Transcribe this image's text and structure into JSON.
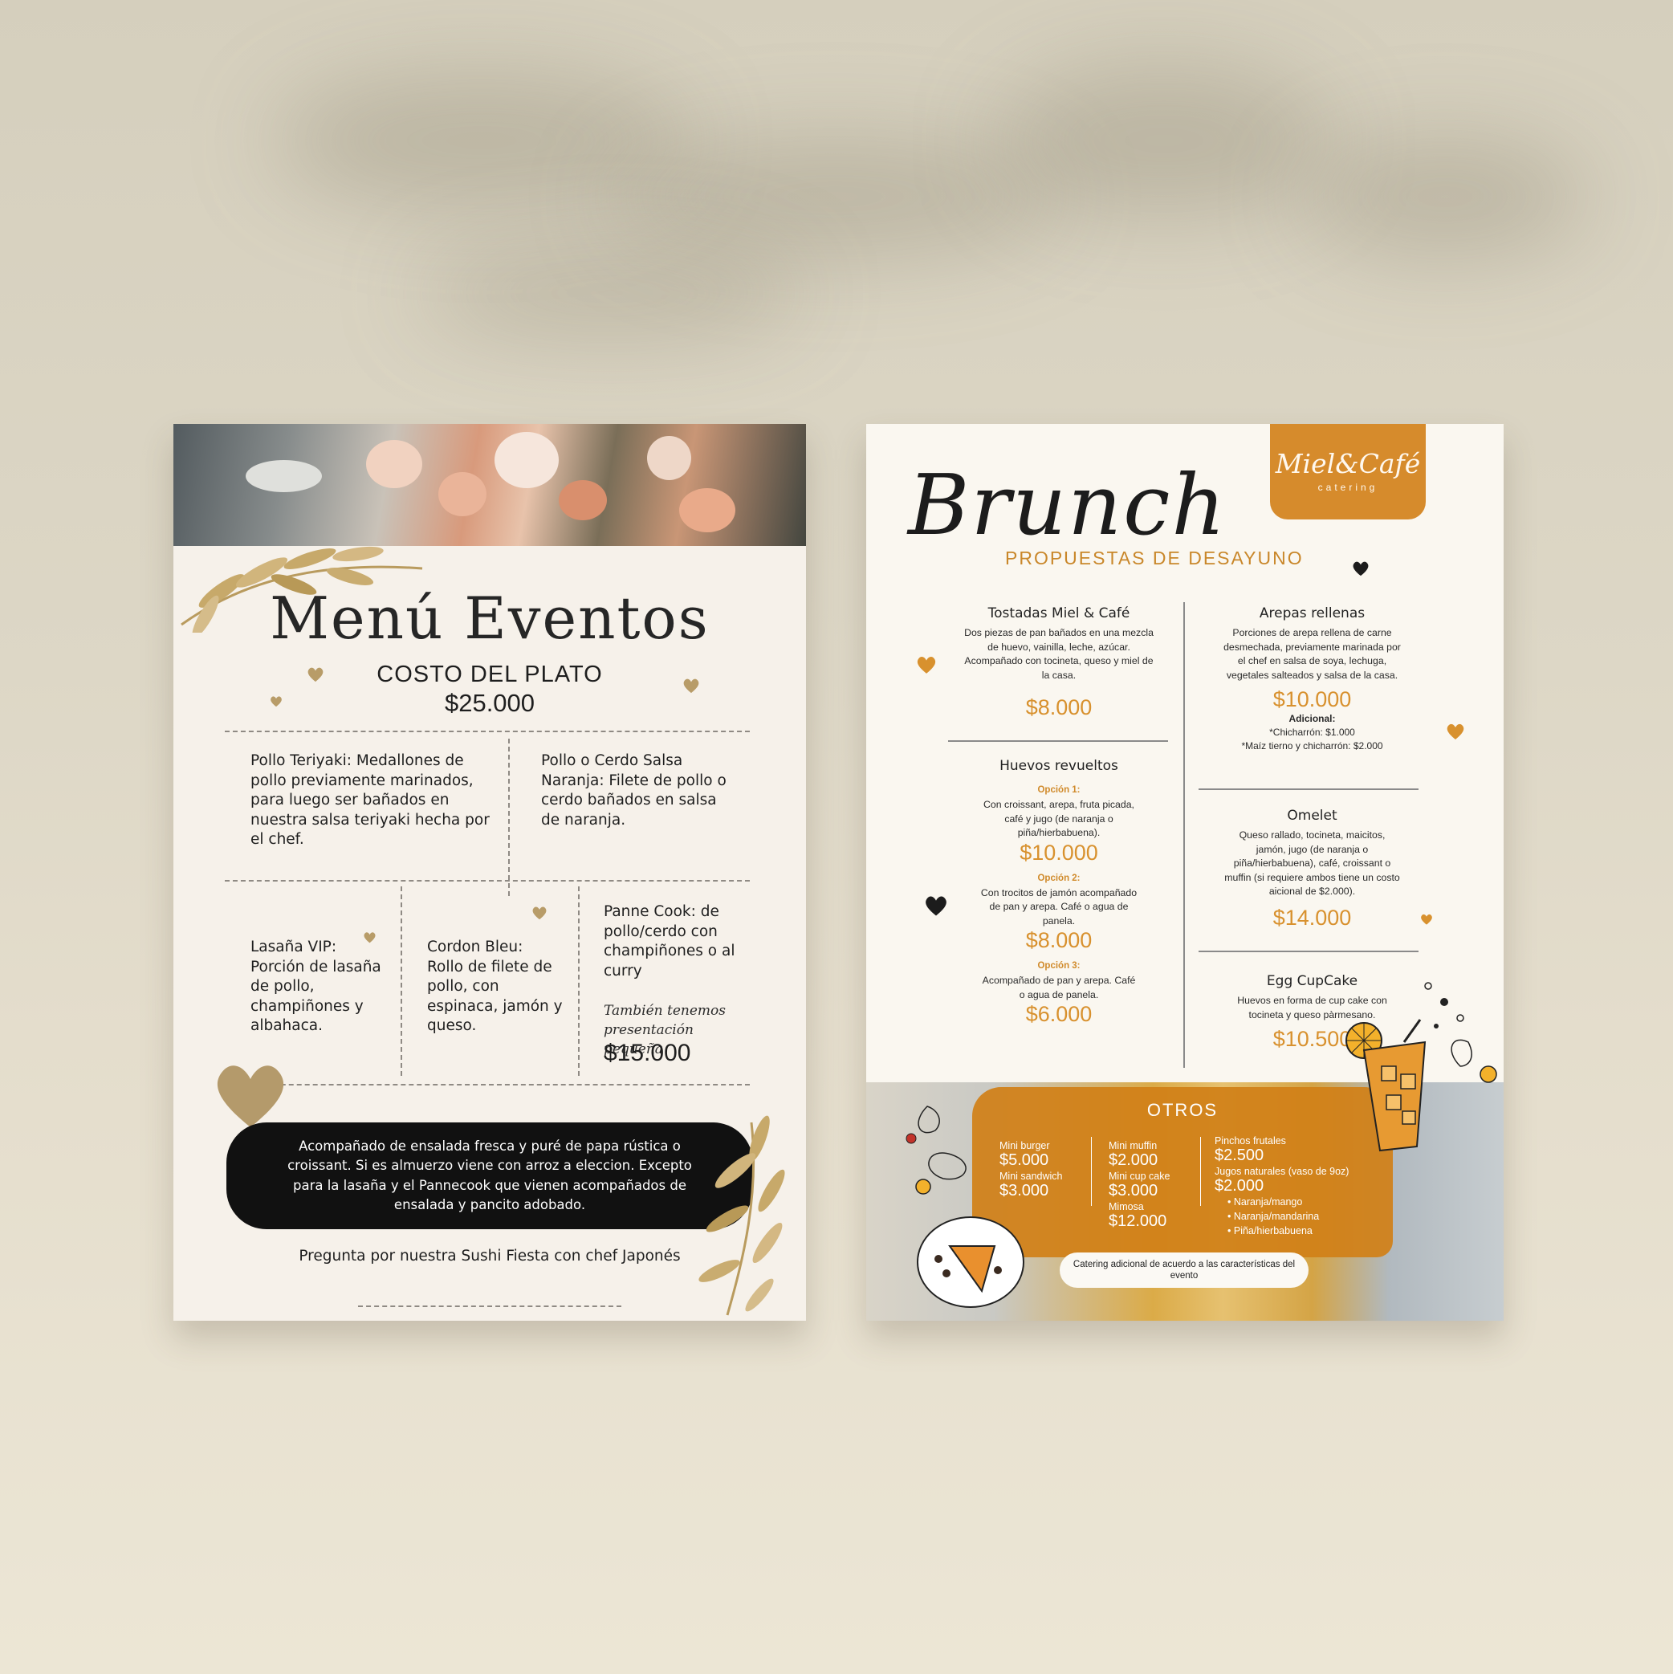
{
  "colors": {
    "background": "#d9d3c2",
    "accent_orange": "#d68b2c",
    "gold_leaf": "#c2a66d",
    "pill_black": "#111111"
  },
  "left_menu": {
    "title": "Menú Eventos",
    "cost_label": "COSTO DEL PLATO",
    "cost_price": "$25.000",
    "items": [
      {
        "text": "Pollo Teriyaki: Medallones de pollo previamente marinados, para luego ser bañados en nuestra salsa teriyaki hecha por el chef."
      },
      {
        "text": "Pollo o Cerdo Salsa Naranja: Filete de pollo o cerdo bañados en salsa de naranja."
      },
      {
        "text": "Lasaña VIP: Porción de lasaña de pollo, champiñones y albahaca."
      },
      {
        "text": "Cordon Bleu: Rollo de filete de pollo, con espinaca, jamón y queso."
      },
      {
        "text": "Panne Cook: de pollo/cerdo con champiñones o al curry"
      }
    ],
    "small_note": "También tenemos presentación pequeña",
    "small_price": "$15.000",
    "accompaniment": "Acompañado de ensalada fresca y puré de papa rústica o croissant. Si es almuerzo viene con arroz a eleccion. Excepto para la lasaña y el Pannecook que vienen acompañados de ensalada y pancito adobado.",
    "sushi": "Pregunta por nuestra Sushi Fiesta con chef Japonés",
    "icons": [
      "heart-icon",
      "leaf-branch-icon"
    ]
  },
  "right_menu": {
    "logo": "Miel&Café",
    "logo_sub": "catering",
    "title": "Brunch",
    "subtitle": "PROPUESTAS DE DESAYUNO",
    "tostadas": {
      "title": "Tostadas Miel & Café",
      "desc": "Dos piezas de pan bañados en una mezcla de huevo, vainilla, leche, azúcar. Acompañado con tocineta, queso y miel de la casa.",
      "price": "$8.000"
    },
    "arepas": {
      "title": "Arepas rellenas",
      "desc": "Porciones de arepa rellena de carne desmechada, previamente marinada por el chef en salsa de soya, lechuga, vegetales salteados y salsa de la casa.",
      "price": "$10.000",
      "extra_label": "Adicional:",
      "extra_1": "*Chicharrón: $1.000",
      "extra_2": "*Maíz tierno y chicharrón: $2.000"
    },
    "huevos": {
      "title": "Huevos revueltos",
      "options": [
        {
          "label": "Opción 1:",
          "desc": "Con croissant, arepa, fruta picada, café y jugo (de naranja o piña/hierbabuena).",
          "price": "$10.000"
        },
        {
          "label": "Opción 2:",
          "desc": "Con trocitos de jamón acompañado de pan y arepa. Café o agua de panela.",
          "price": "$8.000"
        },
        {
          "label": "Opción 3:",
          "desc": "Acompañado de pan y arepa. Café o agua de panela.",
          "price": "$6.000"
        }
      ]
    },
    "omelet": {
      "title": "Omelet",
      "desc": "Queso rallado, tocineta, maicitos, jamón, jugo (de naranja o piña/hierbabuena), café, croissant o muffin (si requiere ambos tiene un costo aicional de $2.000).",
      "price": "$14.000"
    },
    "egg": {
      "title": "Egg CupCake",
      "desc": "Huevos en forma de cup cake con tocineta y queso pàrmesano.",
      "price": "$10.500"
    },
    "otros": {
      "title": "OTROS",
      "mini_burger": "Mini burger",
      "mini_burger_price": "$5.000",
      "mini_sandwich": "Mini sandwich",
      "mini_sandwich_price": "$3.000",
      "mini_muffin": "Mini muffin",
      "mini_muffin_price": "$2.000",
      "mini_cupcake": "Mini cup cake",
      "mini_cupcake_price": "$3.000",
      "mimosa": "Mimosa",
      "mimosa_price": "$12.000",
      "pinchos": "Pinchos frutales",
      "pinchos_price": "$2.500",
      "jugos": "Jugos naturales (vaso de 9oz)",
      "jugos_price": "$2.000",
      "flavors": [
        "Naranja/mango",
        "Naranja/mandarina",
        "Piña/hierbabuena"
      ]
    },
    "catering_note": "Catering adicional de acuerdo a las características del evento",
    "icons": [
      "heart-icon",
      "iced-drink-icon",
      "waffle-plate-icon"
    ]
  }
}
